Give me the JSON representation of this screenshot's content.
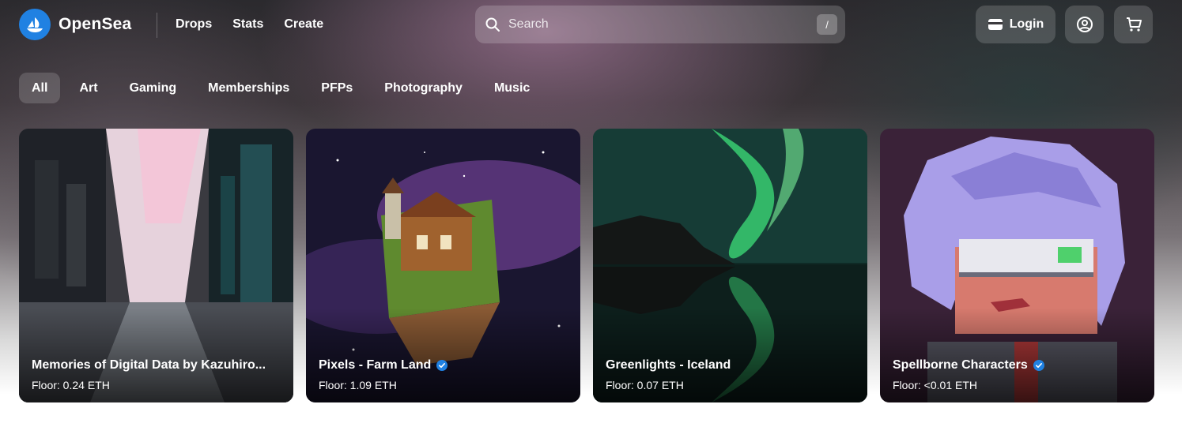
{
  "brand": {
    "name": "OpenSea",
    "accent": "#2081e2"
  },
  "nav": {
    "items": [
      {
        "label": "Drops"
      },
      {
        "label": "Stats"
      },
      {
        "label": "Create"
      }
    ]
  },
  "search": {
    "placeholder": "Search",
    "shortcut": "/"
  },
  "header_actions": {
    "login_label": "Login",
    "profile_icon": "account-circle-icon",
    "cart_icon": "shopping-cart-icon"
  },
  "categories": [
    {
      "label": "All",
      "active": true
    },
    {
      "label": "Art",
      "active": false
    },
    {
      "label": "Gaming",
      "active": false
    },
    {
      "label": "Memberships",
      "active": false
    },
    {
      "label": "PFPs",
      "active": false
    },
    {
      "label": "Photography",
      "active": false
    },
    {
      "label": "Music",
      "active": false
    }
  ],
  "collections": [
    {
      "title": "Memories of Digital Data by Kazuhiro...",
      "floor": "Floor: 0.24 ETH",
      "verified": false
    },
    {
      "title": "Pixels - Farm Land",
      "floor": "Floor: 1.09 ETH",
      "verified": true
    },
    {
      "title": "Greenlights - Iceland",
      "floor": "Floor: 0.07 ETH",
      "verified": false
    },
    {
      "title": "Spellborne Characters",
      "floor": "Floor: <0.01 ETH",
      "verified": true
    }
  ]
}
